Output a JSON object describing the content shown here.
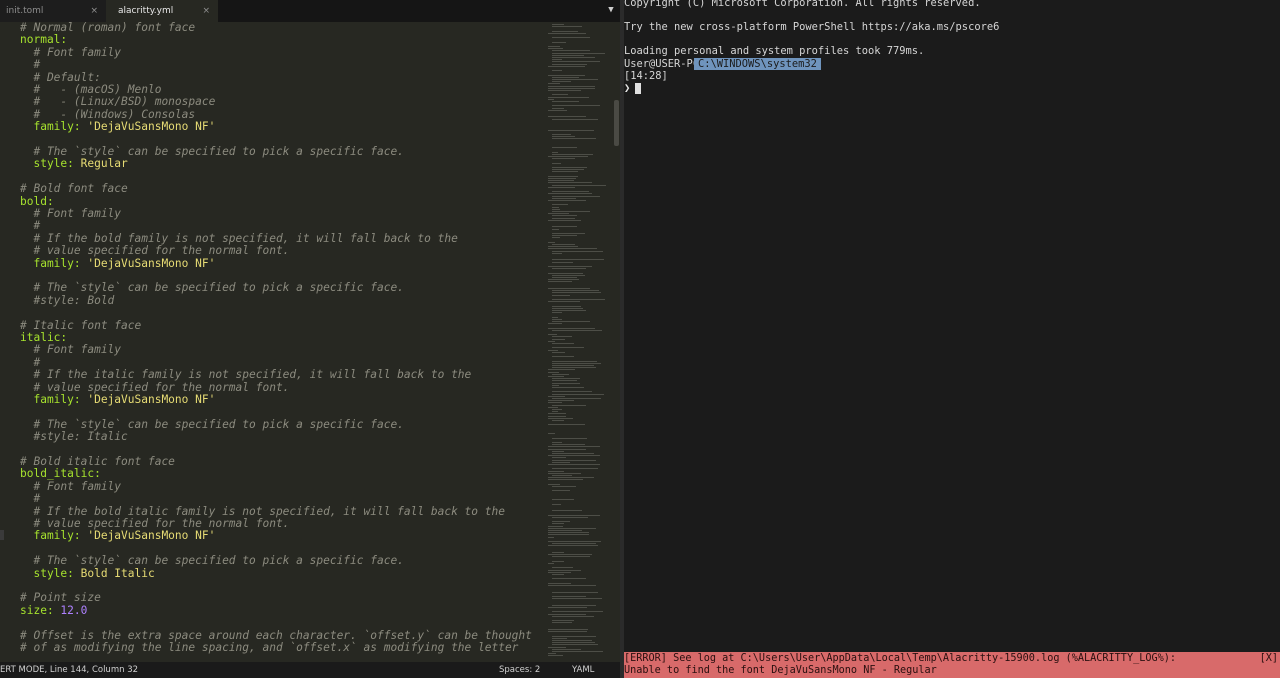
{
  "editor": {
    "tabs": [
      {
        "label": "init.toml",
        "close": "×"
      },
      {
        "label": "alacritty.yml",
        "close": "×"
      }
    ],
    "tab_menu": "▼",
    "lines": [
      [
        {
          "t": "comment",
          "v": "# Normal (roman) font face"
        }
      ],
      [
        {
          "t": "key",
          "v": "normal:"
        }
      ],
      [
        {
          "t": "comment",
          "v": "  # Font family"
        }
      ],
      [
        {
          "t": "comment",
          "v": "  #"
        }
      ],
      [
        {
          "t": "comment",
          "v": "  # Default:"
        }
      ],
      [
        {
          "t": "comment",
          "v": "  #   - (macOS) Menlo"
        }
      ],
      [
        {
          "t": "comment",
          "v": "  #   - (Linux/BSD) monospace"
        }
      ],
      [
        {
          "t": "comment",
          "v": "  #   - (Windows) Consolas"
        }
      ],
      [
        {
          "t": "key",
          "v": "  family: "
        },
        {
          "t": "str",
          "v": "'DejaVuSansMono NF'"
        }
      ],
      [],
      [
        {
          "t": "comment",
          "v": "  # The `style` can be specified to pick a specific face."
        }
      ],
      [
        {
          "t": "key",
          "v": "  style: "
        },
        {
          "t": "str",
          "v": "Regular"
        }
      ],
      [],
      [
        {
          "t": "comment",
          "v": "# Bold font face"
        }
      ],
      [
        {
          "t": "key",
          "v": "bold:"
        }
      ],
      [
        {
          "t": "comment",
          "v": "  # Font family"
        }
      ],
      [
        {
          "t": "comment",
          "v": "  #"
        }
      ],
      [
        {
          "t": "comment",
          "v": "  # If the bold family is not specified, it will fall back to the"
        }
      ],
      [
        {
          "t": "comment",
          "v": "  # value specified for the normal font."
        }
      ],
      [
        {
          "t": "key",
          "v": "  family: "
        },
        {
          "t": "str",
          "v": "'DejaVuSansMono NF'"
        }
      ],
      [],
      [
        {
          "t": "comment",
          "v": "  # The `style` can be specified to pick a specific face."
        }
      ],
      [
        {
          "t": "comment",
          "v": "  #style: Bold"
        }
      ],
      [],
      [
        {
          "t": "comment",
          "v": "# Italic font face"
        }
      ],
      [
        {
          "t": "key",
          "v": "italic:"
        }
      ],
      [
        {
          "t": "comment",
          "v": "  # Font family"
        }
      ],
      [
        {
          "t": "comment",
          "v": "  #"
        }
      ],
      [
        {
          "t": "comment",
          "v": "  # If the italic family is not specified, it will fall back to the"
        }
      ],
      [
        {
          "t": "comment",
          "v": "  # value specified for the normal font."
        }
      ],
      [
        {
          "t": "key",
          "v": "  family: "
        },
        {
          "t": "str",
          "v": "'DejaVuSansMono NF'"
        }
      ],
      [],
      [
        {
          "t": "comment",
          "v": "  # The `style` can be specified to pick a specific face."
        }
      ],
      [
        {
          "t": "comment",
          "v": "  #style: Italic"
        }
      ],
      [],
      [
        {
          "t": "comment",
          "v": "# Bold italic font face"
        }
      ],
      [
        {
          "t": "key",
          "v": "bold_italic:"
        }
      ],
      [
        {
          "t": "comment",
          "v": "  # Font family"
        }
      ],
      [
        {
          "t": "comment",
          "v": "  #"
        }
      ],
      [
        {
          "t": "comment",
          "v": "  # If the bold italic family is not specified, it will fall back to the"
        }
      ],
      [
        {
          "t": "comment",
          "v": "  # value specified for the normal font."
        }
      ],
      [
        {
          "t": "key",
          "v": "  family: "
        },
        {
          "t": "str",
          "v": "'DejaVuSansMono NF'"
        }
      ],
      [],
      [
        {
          "t": "comment",
          "v": "  # The `style` can be specified to pick a specific face."
        }
      ],
      [
        {
          "t": "key",
          "v": "  style: "
        },
        {
          "t": "str",
          "v": "Bold Italic"
        }
      ],
      [],
      [
        {
          "t": "comment",
          "v": "# Point size"
        }
      ],
      [
        {
          "t": "key",
          "v": "size: "
        },
        {
          "t": "num",
          "v": "12.0"
        }
      ],
      [],
      [
        {
          "t": "comment",
          "v": "# Offset is the extra space around each character. `offset.y` can be thought"
        }
      ],
      [
        {
          "t": "comment",
          "v": "# of as modifying the line spacing, and `offset.x` as modifying the letter"
        }
      ]
    ],
    "status": {
      "mode": "ERT MODE, Line 144, Column 32",
      "spaces": "Spaces: 2",
      "syntax": "YAML"
    }
  },
  "terminal": {
    "lines": [
      "Copyright (C) Microsoft Corporation. All rights reserved.",
      "",
      "Try the new cross-platform PowerShell https://aka.ms/pscore6",
      "",
      "Loading personal and system profiles took 779ms."
    ],
    "user_host": "User@USER-PC",
    "path": "C:\\WINDOWS\\system32",
    "time": "[14:28]",
    "prompt": "❯",
    "error": {
      "line1": "[ERROR] See log at C:\\Users\\User\\AppData\\Local\\Temp\\Alacritty-15900.log (%ALACRITTY_LOG%):",
      "line2": "Unable to find the font DejaVuSansMono NF - Regular",
      "close": "[X]"
    }
  }
}
